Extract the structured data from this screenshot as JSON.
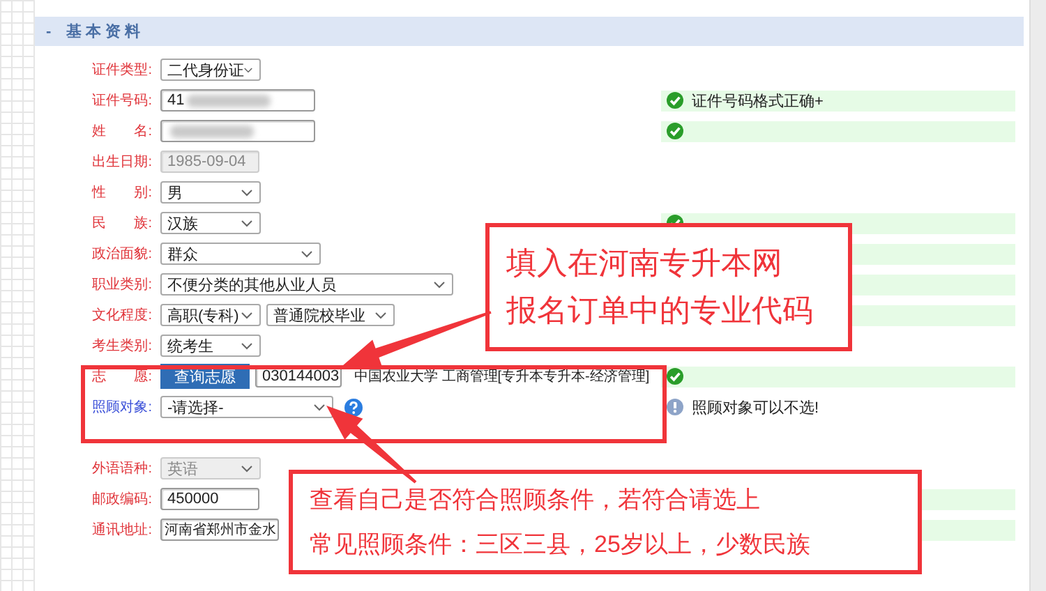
{
  "section": {
    "toggle": "-",
    "title": "基本资料"
  },
  "field_groups": [
    [
      {
        "kind": "select",
        "label": "证件类型:",
        "required": true,
        "value": "二代身份证"
      },
      {
        "kind": "input",
        "label": "证件号码:",
        "required": true,
        "value": "41",
        "redacted": true,
        "status": {
          "kind": "ok",
          "text": "证件号码格式正确+"
        }
      },
      {
        "kind": "input",
        "label": "姓　　名:",
        "required": true,
        "redacted": true,
        "status": {
          "kind": "ok"
        }
      },
      {
        "kind": "input",
        "label": "出生日期:",
        "required": true,
        "value": "1985-09-04",
        "disabled": true
      },
      {
        "kind": "select",
        "label": "性　　别:",
        "required": true,
        "value": "男"
      },
      {
        "kind": "select",
        "label": "民　　族:",
        "required": true,
        "value": "汉族",
        "status": {
          "kind": "ok"
        }
      },
      {
        "kind": "select",
        "label": "政治面貌:",
        "required": true,
        "value": "群众",
        "status": {
          "kind": "plain"
        }
      },
      {
        "kind": "select",
        "label": "职业类别:",
        "required": true,
        "value": "不便分类的其他从业人员",
        "status": {
          "kind": "plain"
        }
      },
      {
        "kind": "select_pair",
        "label": "文化程度:",
        "required": true,
        "values": [
          "高职(专科)",
          "普通院校毕业"
        ],
        "status": {
          "kind": "plain"
        }
      },
      {
        "kind": "select",
        "label": "考生类别:",
        "required": true,
        "value": "统考生"
      },
      {
        "kind": "volunteer",
        "label": "志　　愿:",
        "required": true,
        "button": "查询志愿",
        "value": "030144003",
        "text": "中国农业大学  工商管理[专升本专升本-经济管理]",
        "status": {
          "kind": "ok"
        }
      },
      {
        "kind": "select_help",
        "label": "照顾对象:",
        "required": false,
        "value": "-请选择-",
        "status": {
          "kind": "info",
          "text": "照顾对象可以不选!"
        }
      }
    ],
    [
      {
        "kind": "select",
        "label": "外语语种:",
        "required": true,
        "value": "英语",
        "disabled": true
      },
      {
        "kind": "input",
        "label": "邮政编码:",
        "required": true,
        "value": "450000",
        "status": {
          "kind": "plain"
        }
      },
      {
        "kind": "input",
        "label": "通讯地址:",
        "required": true,
        "value": "河南省郑州市金水",
        "status": {
          "kind": "ok"
        }
      }
    ]
  ],
  "annotations": [
    {
      "kind": "note",
      "lines": [
        "填入在河南专升本网",
        "报名订单中的专业代码"
      ]
    },
    {
      "kind": "highlight"
    },
    {
      "kind": "note",
      "lines": [
        "查看自己是否符合照顾条件，若符合请选上",
        "常见照顾条件：三区三县，25岁以上，少数民族"
      ]
    }
  ]
}
